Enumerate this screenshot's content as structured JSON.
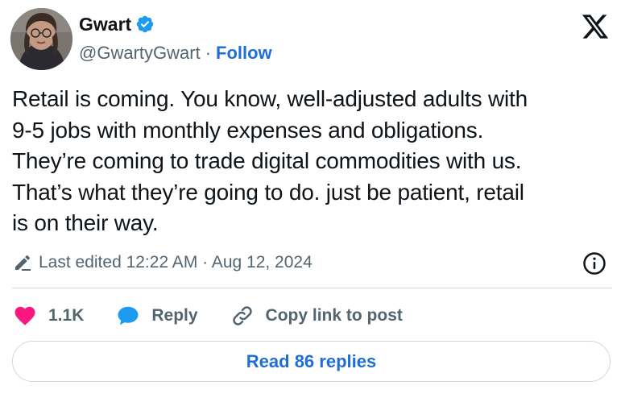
{
  "author": {
    "name": "Gwart",
    "handle": "@GwartyGwart",
    "separator": "·",
    "follow_label": "Follow",
    "verified": true,
    "verified_color": "#1d9bf0"
  },
  "post": {
    "text": "Retail is coming. You know, well-adjusted adults with\n9-5 jobs with monthly expenses and obligations.\nThey’re coming to trade digital commodities with us.\nThat’s what they’re going to do. just be patient, retail\nis on their way."
  },
  "edited": {
    "label": "Last edited 12:22 AM · Aug 12, 2024"
  },
  "actions": {
    "likes": "1.1K",
    "like_color": "#f91880",
    "reply_label": "Reply",
    "reply_color": "#1d9bf0",
    "copy_label": "Copy link to post"
  },
  "replies_button": {
    "label": "Read 86 replies"
  },
  "icons": {
    "platform": "x-logo-icon",
    "verified": "verified-badge-icon",
    "edited": "pencil-icon",
    "info": "info-icon",
    "like": "heart-icon",
    "reply": "speech-bubble-icon",
    "copy": "link-icon"
  }
}
